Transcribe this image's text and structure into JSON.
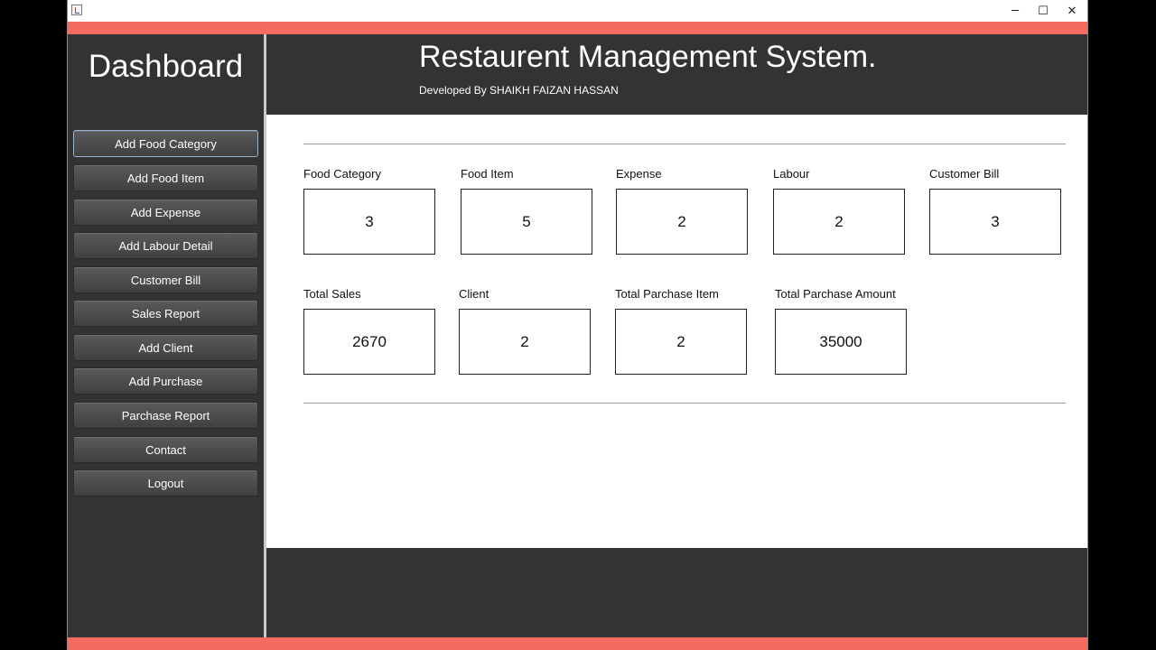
{
  "window": {
    "controls": {
      "minimize": "─",
      "maximize": "☐",
      "close": "✕"
    }
  },
  "colors": {
    "accent": "#f36c5f",
    "panel": "#333333"
  },
  "sidebar": {
    "title": "Dashboard",
    "items": [
      {
        "label": "Add Food Category"
      },
      {
        "label": "Add Food Item"
      },
      {
        "label": "Add Expense"
      },
      {
        "label": "Add Labour Detail"
      },
      {
        "label": "Customer Bill"
      },
      {
        "label": "Sales Report"
      },
      {
        "label": "Add Client"
      },
      {
        "label": "Add Purchase"
      },
      {
        "label": "Parchase Report"
      },
      {
        "label": "Contact"
      },
      {
        "label": "Logout"
      }
    ]
  },
  "header": {
    "title": "Restaurent Management System.",
    "subtitle": "Developed By SHAIKH FAIZAN HASSAN"
  },
  "stats": [
    {
      "label": "Food Category",
      "value": "3"
    },
    {
      "label": "Food Item",
      "value": "5"
    },
    {
      "label": "Expense",
      "value": "2"
    },
    {
      "label": "Labour",
      "value": "2"
    },
    {
      "label": "Customer Bill",
      "value": "3"
    },
    {
      "label": "Total Sales",
      "value": "2670"
    },
    {
      "label": "Client",
      "value": "2"
    },
    {
      "label": "Total Parchase Item",
      "value": "2"
    },
    {
      "label": "Total Parchase Amount",
      "value": "35000"
    }
  ]
}
